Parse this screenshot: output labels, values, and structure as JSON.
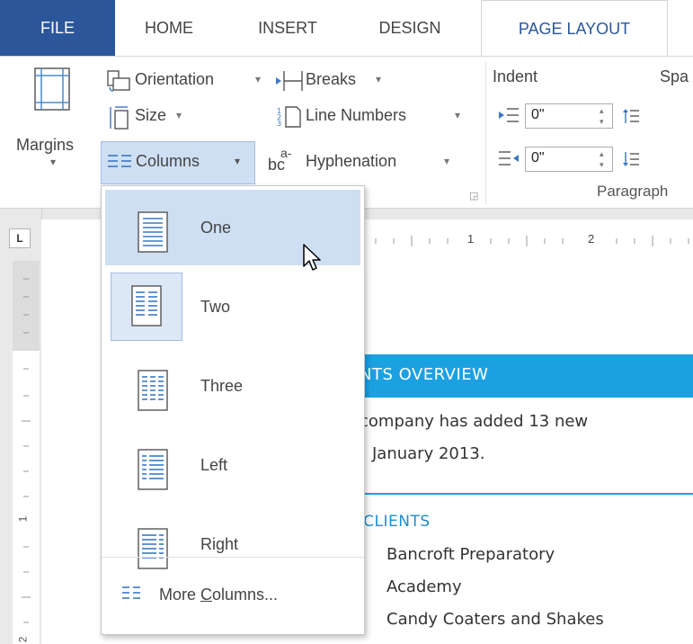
{
  "tabs": {
    "file": "FILE",
    "home": "HOME",
    "insert": "INSERT",
    "design": "DESIGN",
    "page_layout": "PAGE LAYOUT"
  },
  "ribbon": {
    "margins": "Margins",
    "orientation": "Orientation",
    "size": "Size",
    "columns": "Columns",
    "breaks": "Breaks",
    "line_numbers": "Line Numbers",
    "hyphenation": "Hyphenation",
    "indent_label": "Indent",
    "spacing_label": "Spa",
    "indent_left_value": "0\"",
    "indent_right_value": "0\"",
    "paragraph_group": "Paragraph"
  },
  "ruler": {
    "corner": "L",
    "num_1": "1",
    "num_2": "2"
  },
  "columns_menu": {
    "items": [
      {
        "label": "One"
      },
      {
        "label": "Two"
      },
      {
        "label": "Three"
      },
      {
        "label": "Left"
      },
      {
        "label": "Right"
      }
    ],
    "more_prefix": "More ",
    "more_access": "C",
    "more_suffix": "olumns..."
  },
  "document": {
    "heading": "NTS OVERVIEW",
    "para_line1": "company has added 13 new",
    "para_line2": "January 2013.",
    "subheading": "/ CLIENTS",
    "client_1": "Bancroft Preparatory",
    "client_2": "Academy",
    "client_3": "Candy Coaters and Shakes"
  },
  "colors": {
    "accent": "#2b579a",
    "heading_band": "#1ba1e2",
    "menu_hover": "#cfdff3"
  }
}
